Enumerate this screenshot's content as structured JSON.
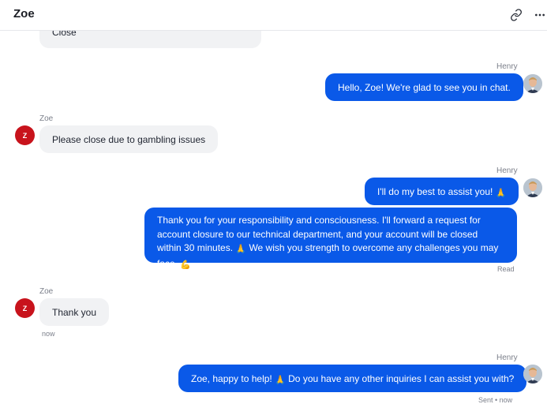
{
  "header": {
    "title": "Zoe",
    "link_icon": "link-icon",
    "more_icon": "more-horizontal-icon"
  },
  "messages": [
    {
      "id": "m0",
      "sender": "",
      "text": "Close",
      "direction": "in"
    },
    {
      "id": "m1",
      "sender": "Henry",
      "text": "Hello, Zoe! We're glad to see you in chat.",
      "direction": "out"
    },
    {
      "id": "m2",
      "sender": "Zoe",
      "text": "Please close due to gambling issues",
      "direction": "in"
    },
    {
      "id": "m3",
      "sender": "Henry",
      "text": "I'll do my best to assist you!",
      "emoji": "🙏",
      "direction": "out"
    },
    {
      "id": "m4",
      "sender": "",
      "direction": "out",
      "text_part1": "Thank you for your responsibility and consciousness. I'll forward a request for account closure to our technical department, and your account will be closed within 30 minutes.",
      "emoji1": "🙏",
      "text_part2": "We wish you strength to overcome any challenges you may face.",
      "emoji2": "💪",
      "status": "Read"
    },
    {
      "id": "m5",
      "sender": "Zoe",
      "text": "Thank you",
      "direction": "in",
      "time": "now"
    },
    {
      "id": "m6",
      "sender": "Henry",
      "direction": "out",
      "text_part1": "Zoe, happy to help!",
      "emoji1": "🙏",
      "text_part2": "Do you have any other inquiries I can assist you with?",
      "status": "Sent • now"
    }
  ],
  "avatars": {
    "zoe_initial": "Z"
  },
  "colors": {
    "outgoing_bubble": "#0a59e8",
    "incoming_bubble": "#f1f2f4",
    "zoe_avatar": "#c8131c"
  }
}
